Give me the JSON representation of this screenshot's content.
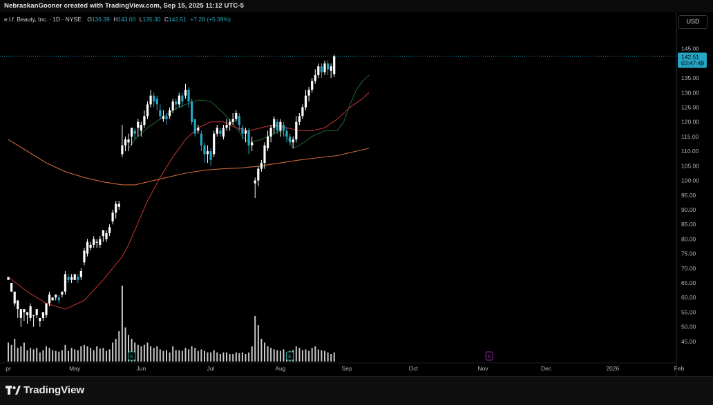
{
  "header": {
    "attribution": "NebraskanGooner created with TradingView.com, Sep 15, 2025 11:12 UTC-5"
  },
  "legend": {
    "symbol": "e.l.f. Beauty, Inc. · 1D · NYSE",
    "open_label": "O",
    "open": "136.39",
    "high_label": "H",
    "high": "143.00",
    "low_label": "L",
    "low": "135.30",
    "close_label": "C",
    "close": "142.51",
    "change": "+7.28 (+5.39%)"
  },
  "currency_button": "USD",
  "price_label": {
    "price": "142.51",
    "countdown": "03:47:49"
  },
  "earnings_marker": "E",
  "footer": {
    "brand": "TradingView"
  },
  "colors": {
    "background": "#000000",
    "up_candle": "#ffffff",
    "down_candle": "#26a6c4",
    "ma_fast": "#1f5f2e",
    "ma_mid": "#b8312f",
    "ma_slow": "#c8683a",
    "volume": "#c9c9c9",
    "earnings": "#26a69a",
    "earnings_future": "#9c27b0",
    "price_line": "#26a6c4"
  },
  "chart_data": {
    "type": "candlestick",
    "y_axis": {
      "ticks": [
        45,
        50,
        55,
        60,
        65,
        70,
        75,
        80,
        85,
        90,
        95,
        100,
        105,
        110,
        115,
        120,
        125,
        130,
        135,
        140,
        145
      ],
      "range": [
        40,
        148
      ],
      "side": "right"
    },
    "x_axis": {
      "ticks": [
        {
          "label": "pr",
          "day": 0
        },
        {
          "label": "May",
          "day": 21
        },
        {
          "label": "Jun",
          "day": 42
        },
        {
          "label": "Jul",
          "day": 64
        },
        {
          "label": "Aug",
          "day": 86
        },
        {
          "label": "Sep",
          "day": 107
        },
        {
          "label": "Oct",
          "day": 128
        },
        {
          "label": "Nov",
          "day": 150
        },
        {
          "label": "Dec",
          "day": 170
        },
        {
          "label": "2026",
          "day": 191
        },
        {
          "label": "Feb",
          "day": 212
        }
      ]
    },
    "earnings_days": [
      39,
      89
    ],
    "future_earnings_day": 152,
    "last_close": 142.51,
    "moving_averages": [
      {
        "color": "ma_fast",
        "points": [
          [
            38,
            111
          ],
          [
            40,
            114
          ],
          [
            44,
            118
          ],
          [
            48,
            121
          ],
          [
            52,
            124
          ],
          [
            56,
            126
          ],
          [
            60,
            127.5
          ],
          [
            64,
            127
          ],
          [
            68,
            123
          ],
          [
            72,
            118
          ],
          [
            74,
            115
          ],
          [
            76,
            113
          ],
          [
            80,
            114
          ],
          [
            84,
            116
          ],
          [
            86,
            117
          ],
          [
            88,
            115
          ],
          [
            90,
            111
          ],
          [
            92,
            112
          ],
          [
            96,
            115
          ],
          [
            100,
            117
          ],
          [
            104,
            117
          ],
          [
            106,
            120
          ],
          [
            108,
            126
          ],
          [
            110,
            131
          ],
          [
            112,
            134
          ],
          [
            114,
            136
          ]
        ]
      },
      {
        "color": "ma_mid",
        "points": [
          [
            0,
            67
          ],
          [
            6,
            62
          ],
          [
            12,
            58
          ],
          [
            18,
            56
          ],
          [
            24,
            59
          ],
          [
            30,
            66
          ],
          [
            36,
            74
          ],
          [
            38,
            78
          ],
          [
            40,
            83
          ],
          [
            44,
            93
          ],
          [
            48,
            101
          ],
          [
            52,
            108
          ],
          [
            56,
            114
          ],
          [
            60,
            118
          ],
          [
            64,
            120
          ],
          [
            68,
            120
          ],
          [
            72,
            118
          ],
          [
            76,
            117
          ],
          [
            80,
            118
          ],
          [
            84,
            119
          ],
          [
            88,
            118
          ],
          [
            92,
            117
          ],
          [
            96,
            117
          ],
          [
            100,
            118
          ],
          [
            104,
            121
          ],
          [
            108,
            125
          ],
          [
            112,
            128
          ],
          [
            114,
            130
          ]
        ]
      },
      {
        "color": "ma_slow",
        "points": [
          [
            0,
            114
          ],
          [
            6,
            110
          ],
          [
            12,
            106
          ],
          [
            18,
            103
          ],
          [
            24,
            101
          ],
          [
            30,
            99.5
          ],
          [
            36,
            98.5
          ],
          [
            40,
            98.5
          ],
          [
            44,
            99.5
          ],
          [
            50,
            101
          ],
          [
            56,
            102.5
          ],
          [
            62,
            103.5
          ],
          [
            68,
            104
          ],
          [
            74,
            104.3
          ],
          [
            80,
            105
          ],
          [
            86,
            106
          ],
          [
            92,
            107
          ],
          [
            98,
            107.8
          ],
          [
            104,
            108.5
          ],
          [
            110,
            110
          ],
          [
            114,
            111
          ]
        ]
      }
    ],
    "candles": [
      [
        0,
        66,
        67,
        63,
        70
      ],
      [
        1,
        62,
        65,
        57,
        63
      ],
      [
        2,
        58,
        62,
        55,
        57
      ],
      [
        3,
        56,
        59,
        52,
        53
      ],
      [
        4,
        53,
        56,
        51,
        50
      ],
      [
        5,
        55,
        56,
        53,
        52
      ],
      [
        6,
        54,
        55,
        52,
        51
      ],
      [
        7,
        53,
        57,
        58,
        52
      ],
      [
        8,
        54,
        54,
        52,
        50
      ],
      [
        9,
        54,
        56,
        53,
        53
      ],
      [
        10,
        52,
        53,
        51,
        50
      ],
      [
        11,
        53,
        55,
        52,
        52
      ],
      [
        12,
        54,
        58,
        58,
        53
      ],
      [
        13,
        58,
        61,
        62,
        57
      ],
      [
        14,
        59,
        60,
        58,
        59
      ],
      [
        15,
        60,
        61,
        60,
        59
      ],
      [
        16,
        60,
        59,
        61,
        58
      ],
      [
        17,
        61,
        62,
        61,
        60
      ],
      [
        18,
        62,
        68,
        69,
        61
      ],
      [
        19,
        67,
        66,
        68,
        65
      ],
      [
        20,
        66,
        67,
        68,
        65
      ],
      [
        21,
        66,
        68,
        68,
        66
      ],
      [
        22,
        67,
        66,
        68,
        65
      ],
      [
        23,
        67,
        69,
        70,
        66
      ],
      [
        24,
        72,
        76,
        77,
        71
      ],
      [
        25,
        75,
        79,
        80,
        74
      ],
      [
        26,
        77,
        78,
        79,
        76
      ],
      [
        27,
        78,
        80,
        81,
        77
      ],
      [
        28,
        79,
        79,
        80,
        77
      ],
      [
        29,
        78,
        80,
        81,
        77
      ],
      [
        30,
        81,
        83,
        83,
        79
      ],
      [
        31,
        80,
        82,
        83,
        79
      ],
      [
        32,
        82,
        84,
        85,
        81
      ],
      [
        33,
        86,
        89,
        90,
        85
      ],
      [
        34,
        89,
        92,
        93,
        87
      ],
      [
        35,
        91,
        92,
        93,
        90
      ],
      [
        36,
        109,
        112,
        119,
        108
      ],
      [
        37,
        112,
        114,
        115,
        110
      ],
      [
        38,
        113,
        114,
        116,
        110
      ],
      [
        39,
        115,
        118,
        118,
        112
      ],
      [
        40,
        117,
        116,
        118,
        114
      ],
      [
        41,
        118,
        120,
        121,
        115
      ],
      [
        42,
        117,
        119,
        120,
        115
      ],
      [
        43,
        119,
        122,
        124,
        118
      ],
      [
        44,
        122,
        126,
        127,
        121
      ],
      [
        45,
        126,
        129,
        131,
        125
      ],
      [
        46,
        129,
        127,
        130,
        125
      ],
      [
        47,
        128,
        126,
        129,
        124
      ],
      [
        48,
        124,
        122,
        126,
        121
      ],
      [
        49,
        121,
        122,
        124,
        120
      ],
      [
        50,
        122,
        121,
        123,
        119
      ],
      [
        51,
        122,
        124,
        125,
        121
      ],
      [
        52,
        124,
        127,
        128,
        123
      ],
      [
        53,
        127,
        126,
        128,
        124
      ],
      [
        54,
        126,
        129,
        130,
        125
      ],
      [
        55,
        129,
        127,
        130,
        125
      ],
      [
        56,
        129,
        131,
        133,
        128
      ],
      [
        57,
        131,
        127,
        132,
        125
      ],
      [
        58,
        127,
        120,
        128,
        119
      ],
      [
        59,
        121,
        116,
        121,
        115
      ],
      [
        60,
        117,
        118,
        119,
        116
      ],
      [
        61,
        116,
        112,
        117,
        110
      ],
      [
        62,
        112,
        109,
        113,
        106
      ],
      [
        63,
        109,
        110,
        112,
        106
      ],
      [
        64,
        110,
        107,
        111,
        105
      ],
      [
        65,
        109,
        116,
        117,
        108
      ],
      [
        66,
        116,
        118,
        119,
        115
      ],
      [
        67,
        117,
        116,
        118,
        115
      ],
      [
        68,
        115,
        118,
        119,
        114
      ],
      [
        69,
        118,
        119,
        121,
        117
      ],
      [
        70,
        119,
        120,
        121,
        117
      ],
      [
        71,
        120,
        121,
        123,
        119
      ],
      [
        72,
        121,
        123,
        124,
        120
      ],
      [
        73,
        122,
        119,
        123,
        117
      ],
      [
        74,
        118,
        116,
        119,
        114
      ],
      [
        75,
        116,
        117,
        118,
        113
      ],
      [
        76,
        117,
        112,
        118,
        109
      ],
      [
        77,
        112,
        113,
        115,
        110
      ],
      [
        78,
        99,
        100,
        101,
        94
      ],
      [
        79,
        100,
        104,
        105,
        98
      ],
      [
        80,
        104,
        106,
        107,
        103
      ],
      [
        81,
        106,
        112,
        113,
        104
      ],
      [
        82,
        111,
        115,
        117,
        110
      ],
      [
        83,
        115,
        118,
        119,
        113
      ],
      [
        84,
        118,
        121,
        122,
        116
      ],
      [
        85,
        120,
        117,
        121,
        116
      ],
      [
        86,
        117,
        120,
        121,
        115
      ],
      [
        87,
        119,
        117,
        120,
        115
      ],
      [
        88,
        117,
        115,
        118,
        113
      ],
      [
        89,
        115,
        113,
        116,
        112
      ],
      [
        90,
        113,
        114,
        115,
        111
      ],
      [
        91,
        114,
        120,
        122,
        113
      ],
      [
        92,
        120,
        122,
        123,
        119
      ],
      [
        93,
        122,
        125,
        126,
        121
      ],
      [
        94,
        125,
        129,
        131,
        124
      ],
      [
        95,
        129,
        131,
        132,
        127
      ],
      [
        96,
        131,
        134,
        135,
        130
      ],
      [
        97,
        134,
        136,
        138,
        133
      ],
      [
        98,
        136,
        139,
        140,
        135
      ],
      [
        99,
        139,
        137,
        140,
        135
      ],
      [
        100,
        137,
        140,
        141,
        136
      ],
      [
        101,
        140,
        138,
        141,
        136
      ],
      [
        102,
        137.5,
        139,
        140,
        135
      ],
      [
        103,
        136.39,
        142.51,
        143,
        135.3
      ]
    ],
    "volume": [
      [
        0,
        0.25
      ],
      [
        1,
        0.22
      ],
      [
        2,
        0.3
      ],
      [
        3,
        0.18
      ],
      [
        4,
        0.2
      ],
      [
        5,
        0.25
      ],
      [
        6,
        0.15
      ],
      [
        7,
        0.18
      ],
      [
        8,
        0.16
      ],
      [
        9,
        0.18
      ],
      [
        10,
        0.12
      ],
      [
        11,
        0.15
      ],
      [
        12,
        0.2
      ],
      [
        13,
        0.18
      ],
      [
        14,
        0.15
      ],
      [
        15,
        0.14
      ],
      [
        16,
        0.13
      ],
      [
        17,
        0.15
      ],
      [
        18,
        0.22
      ],
      [
        19,
        0.14
      ],
      [
        20,
        0.18
      ],
      [
        21,
        0.16
      ],
      [
        22,
        0.15
      ],
      [
        23,
        0.2
      ],
      [
        24,
        0.22
      ],
      [
        25,
        0.2
      ],
      [
        26,
        0.18
      ],
      [
        27,
        0.15
      ],
      [
        28,
        0.2
      ],
      [
        29,
        0.17
      ],
      [
        30,
        0.18
      ],
      [
        31,
        0.14
      ],
      [
        32,
        0.16
      ],
      [
        33,
        0.25
      ],
      [
        34,
        0.3
      ],
      [
        35,
        0.4
      ],
      [
        36,
        1.0
      ],
      [
        37,
        0.45
      ],
      [
        38,
        0.35
      ],
      [
        39,
        0.3
      ],
      [
        40,
        0.25
      ],
      [
        41,
        0.22
      ],
      [
        42,
        0.2
      ],
      [
        43,
        0.22
      ],
      [
        44,
        0.25
      ],
      [
        45,
        0.2
      ],
      [
        46,
        0.18
      ],
      [
        47,
        0.2
      ],
      [
        48,
        0.16
      ],
      [
        49,
        0.14
      ],
      [
        50,
        0.15
      ],
      [
        51,
        0.12
      ],
      [
        52,
        0.2
      ],
      [
        53,
        0.15
      ],
      [
        54,
        0.15
      ],
      [
        55,
        0.14
      ],
      [
        56,
        0.18
      ],
      [
        57,
        0.16
      ],
      [
        58,
        0.2
      ],
      [
        59,
        0.18
      ],
      [
        60,
        0.14
      ],
      [
        61,
        0.16
      ],
      [
        62,
        0.14
      ],
      [
        63,
        0.12
      ],
      [
        64,
        0.12
      ],
      [
        65,
        0.15
      ],
      [
        66,
        0.12
      ],
      [
        67,
        0.1
      ],
      [
        68,
        0.12
      ],
      [
        69,
        0.12
      ],
      [
        70,
        0.1
      ],
      [
        71,
        0.1
      ],
      [
        72,
        0.12
      ],
      [
        73,
        0.11
      ],
      [
        74,
        0.12
      ],
      [
        75,
        0.1
      ],
      [
        76,
        0.12
      ],
      [
        77,
        0.2
      ],
      [
        78,
        0.6
      ],
      [
        79,
        0.48
      ],
      [
        80,
        0.3
      ],
      [
        81,
        0.25
      ],
      [
        82,
        0.2
      ],
      [
        83,
        0.18
      ],
      [
        84,
        0.16
      ],
      [
        85,
        0.15
      ],
      [
        86,
        0.14
      ],
      [
        87,
        0.16
      ],
      [
        88,
        0.12
      ],
      [
        89,
        0.14
      ],
      [
        90,
        0.15
      ],
      [
        91,
        0.2
      ],
      [
        92,
        0.18
      ],
      [
        93,
        0.15
      ],
      [
        94,
        0.16
      ],
      [
        95,
        0.14
      ],
      [
        96,
        0.18
      ],
      [
        97,
        0.2
      ],
      [
        98,
        0.16
      ],
      [
        99,
        0.15
      ],
      [
        100,
        0.14
      ],
      [
        101,
        0.12
      ],
      [
        102,
        0.1
      ],
      [
        103,
        0.12
      ]
    ]
  }
}
